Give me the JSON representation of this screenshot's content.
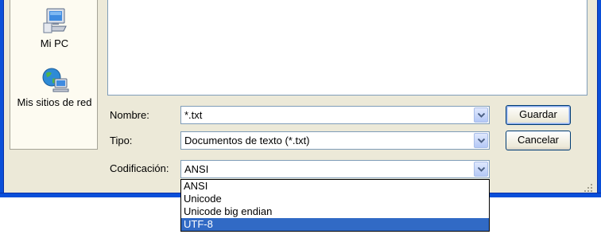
{
  "places_bar": {
    "items": [
      {
        "label": "Mi PC",
        "icon": "my-computer-icon"
      },
      {
        "label": "Mis sitios de red",
        "icon": "network-places-icon"
      }
    ]
  },
  "form": {
    "name_label": "Nombre:",
    "name_value": "*.txt",
    "type_label": "Tipo:",
    "type_value": "Documentos de texto (*.txt)",
    "encoding_label": "Codificación:",
    "encoding_value": "ANSI"
  },
  "buttons": {
    "save_label": "Guardar",
    "cancel_label": "Cancelar"
  },
  "encoding_options": [
    "ANSI",
    "Unicode",
    "Unicode big endian",
    "UTF-8"
  ],
  "encoding_highlighted": "UTF-8",
  "colors": {
    "window_frame": "#0a4fd9",
    "dialog_background": "#ece9d8",
    "selection": "#316ac5"
  }
}
